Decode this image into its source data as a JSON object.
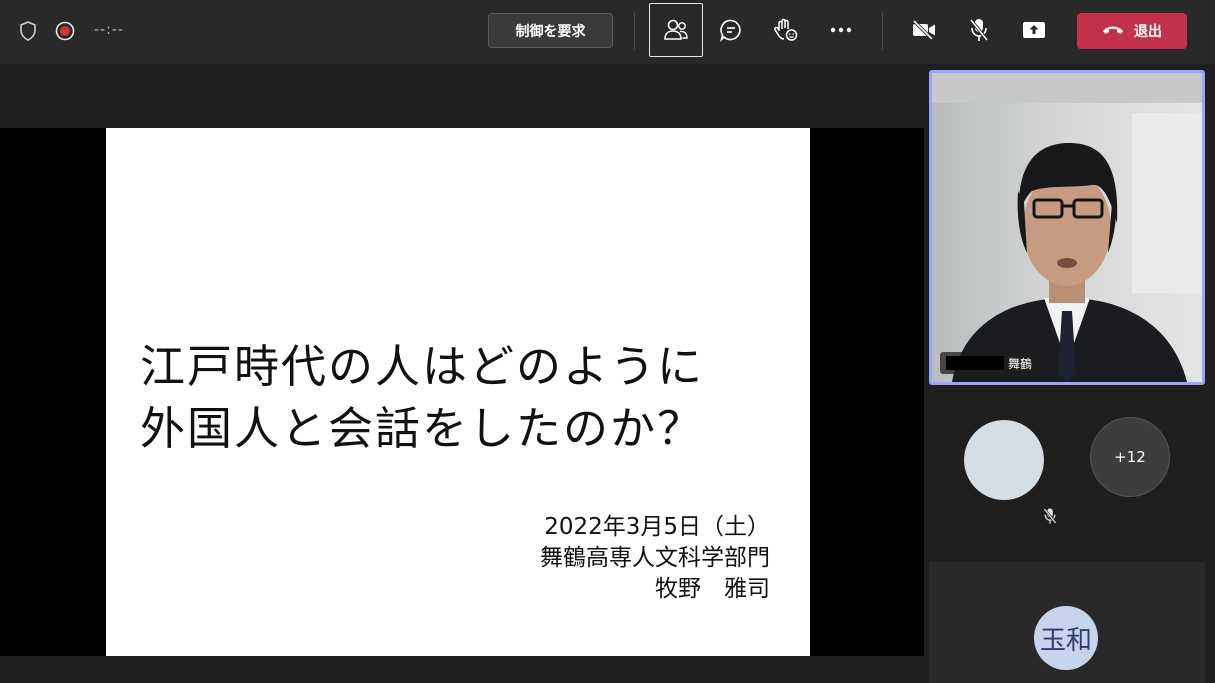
{
  "topbar": {
    "timer": "--:--",
    "request_control": "制御を要求",
    "leave": "退出"
  },
  "slide": {
    "title_line1": "江戸時代の人はどのように",
    "title_line2": "外国人と会話をしたのか？",
    "date": "2022年3月5日（土）",
    "department": "舞鶴高専人文科学部門",
    "author": "牧野　雅司"
  },
  "video": {
    "name_suffix": "舞鶴"
  },
  "participants": {
    "more_count": "+12",
    "initials": "玉和"
  },
  "colors": {
    "leave": "#c4314b",
    "active_speaker_border": "#9ea2ff"
  }
}
